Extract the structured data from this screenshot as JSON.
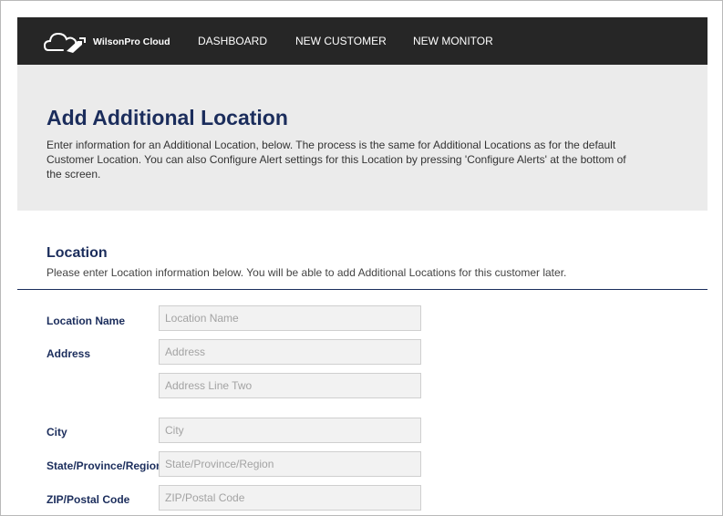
{
  "navbar": {
    "brand": "WilsonPro Cloud",
    "links": [
      "DASHBOARD",
      "NEW CUSTOMER",
      "NEW MONITOR"
    ]
  },
  "hero": {
    "title": "Add Additional Location",
    "description": "Enter information for an Additional Location, below. The process is the same for Additional Locations as for the default Customer Location. You can also Configure Alert settings for this Location by pressing 'Configure Alerts' at the bottom of the screen."
  },
  "location": {
    "title": "Location",
    "description": "Please enter Location information below. You will be able to add Additional Locations for this customer later.",
    "labels": {
      "location_name": "Location Name",
      "address": "Address",
      "city": "City",
      "state": "State/Province/Region",
      "zip": "ZIP/Postal Code"
    },
    "placeholders": {
      "location_name": "Location Name",
      "address": "Address",
      "address_two": "Address Line Two",
      "city": "City",
      "state": "State/Province/Region",
      "zip": "ZIP/Postal Code"
    }
  },
  "colors": {
    "navbar_bg": "#262626",
    "heading": "#1b2d5c",
    "hero_bg": "#ebebeb",
    "field_bg": "#f2f2f2"
  },
  "icons": {
    "logo": "cloud-with-wrench-icon"
  }
}
